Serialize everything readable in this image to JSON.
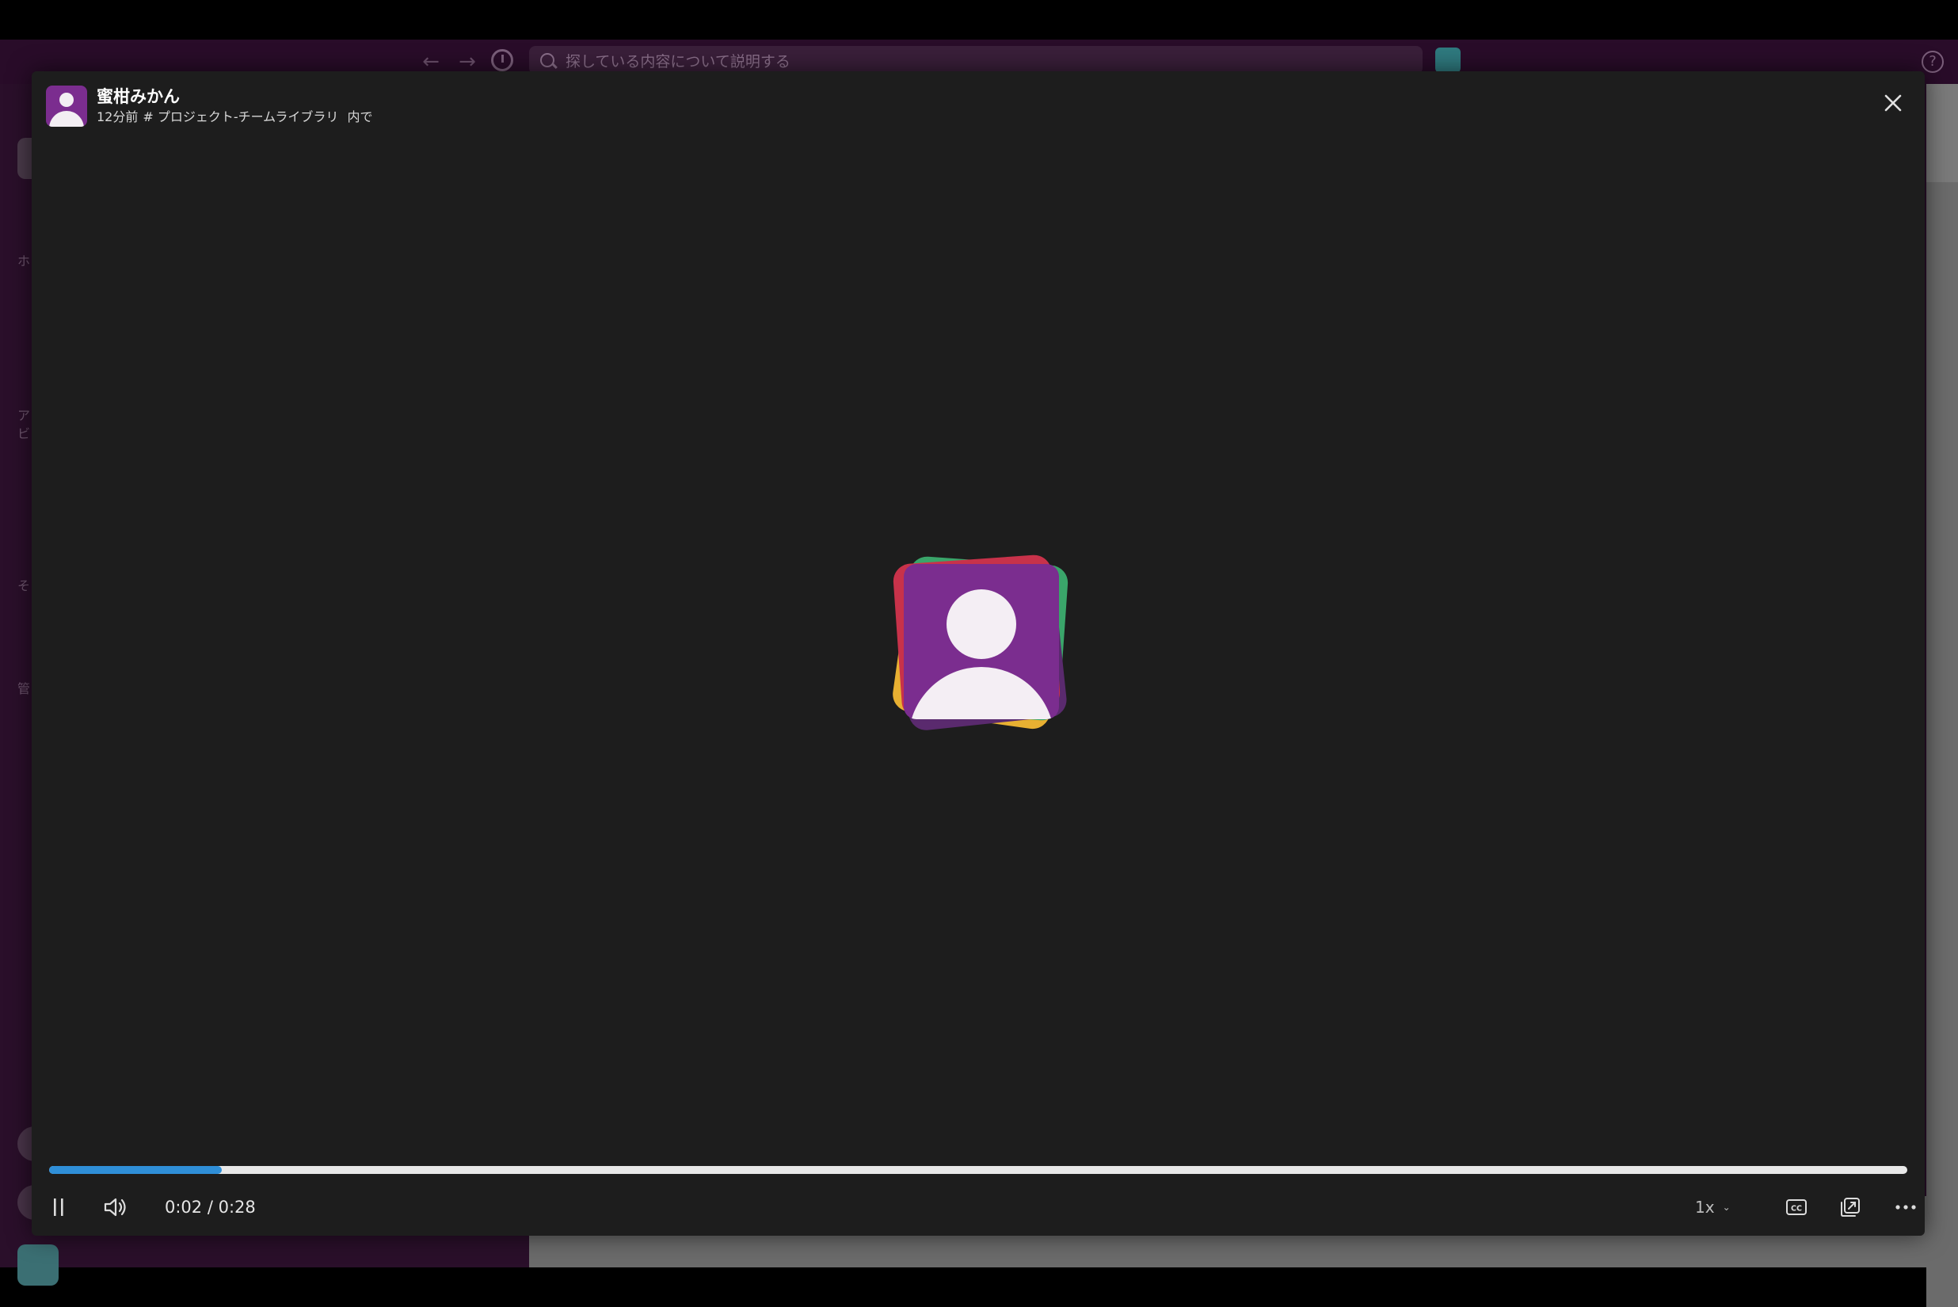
{
  "background_app": {
    "search_placeholder": "探している内容について説明する",
    "sidebar_glyphs": [
      "ホ",
      "ア",
      "ビ",
      "そ",
      "管"
    ],
    "help_label": "?"
  },
  "viewer": {
    "author_name": "蜜柑みかん",
    "time_ago": "12分前",
    "channel": "# プロジェクト-チームライブラリ",
    "channel_suffix": "内で",
    "time_display": "0:02 / 0:28",
    "progress_fraction": 0.0929,
    "speed_label": "1x",
    "colors": {
      "avatar_purple": "#7b2d8f",
      "progress_blue": "#2f8fd8",
      "stack_red": "#c8324a",
      "stack_yellow": "#e8b032",
      "stack_green": "#3aa56a",
      "stack_dark_purple": "#5a2a6e"
    },
    "icons": {
      "close": "close-icon",
      "pause": "pause-icon",
      "volume": "volume-icon",
      "captions": "captions-icon",
      "popout": "popout-icon",
      "more": "more-icon"
    }
  }
}
